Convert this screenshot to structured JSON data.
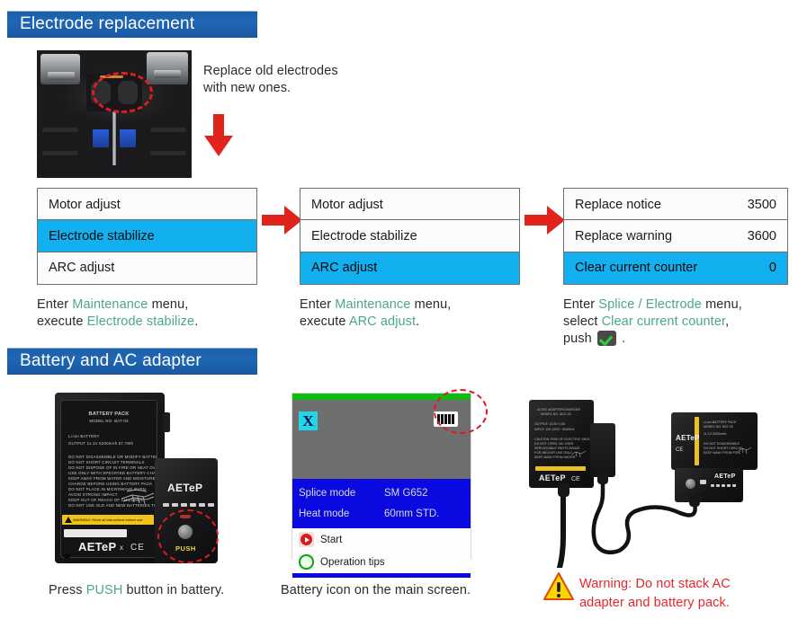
{
  "sections": {
    "electrode": {
      "banner_title": "Electrode replacement",
      "intro_line1": "Replace old electrodes",
      "intro_line2": "with new ones.",
      "photo_name": "splicer-electrode-photo"
    },
    "battery": {
      "banner_title": "Battery and AC adapter"
    }
  },
  "menus": [
    {
      "name": "maintenance-menu-electrode-stabilize",
      "rows": [
        {
          "label": "Motor adjust",
          "value": "",
          "selected": false
        },
        {
          "label": "Electrode stabilize",
          "value": "",
          "selected": true
        },
        {
          "label": "ARC adjust",
          "value": "",
          "selected": false
        }
      ],
      "caption": {
        "parts": [
          {
            "text": "Enter ",
            "style": "plain"
          },
          {
            "text": "Maintenance",
            "style": "highlight"
          },
          {
            "text": " menu,",
            "style": "plain"
          },
          {
            "text": "\n",
            "style": "break"
          },
          {
            "text": "execute ",
            "style": "plain"
          },
          {
            "text": "Electrode stabilize",
            "style": "highlight"
          },
          {
            "text": ".",
            "style": "plain"
          }
        ]
      }
    },
    {
      "name": "maintenance-menu-arc-adjust",
      "rows": [
        {
          "label": "Motor adjust",
          "value": "",
          "selected": false
        },
        {
          "label": "Electrode stabilize",
          "value": "",
          "selected": false
        },
        {
          "label": "ARC adjust",
          "value": "",
          "selected": true
        }
      ],
      "caption": {
        "parts": [
          {
            "text": "Enter ",
            "style": "plain"
          },
          {
            "text": "Maintenance",
            "style": "highlight"
          },
          {
            "text": " menu,",
            "style": "plain"
          },
          {
            "text": "\n",
            "style": "break"
          },
          {
            "text": "execute ",
            "style": "plain"
          },
          {
            "text": "ARC adjust",
            "style": "highlight"
          },
          {
            "text": ".",
            "style": "plain"
          }
        ]
      }
    },
    {
      "name": "splice-electrode-menu",
      "rows": [
        {
          "label": "Replace notice",
          "value": "3500",
          "selected": false
        },
        {
          "label": "Replace warning",
          "value": "3600",
          "selected": false
        },
        {
          "label": "Clear current counter",
          "value": "0",
          "selected": true
        }
      ],
      "caption": {
        "parts": [
          {
            "text": "Enter ",
            "style": "plain"
          },
          {
            "text": "Splice / Electrode",
            "style": "highlight"
          },
          {
            "text": " menu,",
            "style": "plain"
          },
          {
            "text": "\n",
            "style": "break"
          },
          {
            "text": "select ",
            "style": "plain"
          },
          {
            "text": "Clear current counter",
            "style": "highlight"
          },
          {
            "text": ",",
            "style": "plain"
          },
          {
            "text": "\n",
            "style": "break"
          },
          {
            "text": "push ",
            "style": "plain"
          },
          {
            "text": "",
            "style": "checkmark-icon"
          },
          {
            "text": " .",
            "style": "plain"
          }
        ]
      }
    }
  ],
  "arrows": [
    {
      "name": "arrow-down-photo-to-menu",
      "direction": "down"
    },
    {
      "name": "arrow-right-menu1-to-menu2",
      "direction": "right"
    },
    {
      "name": "arrow-right-menu2-to-menu3",
      "direction": "right"
    }
  ],
  "battery_pack": {
    "title": "BATTERY PACK",
    "model": "MODEL NO. BAT-03",
    "type": "Li-ion BATTERY",
    "output": "OUTPUT    11.1V  5200mAh  57.7Wh",
    "notes": [
      "DO NOT DISASSEMBLE OR MODIFY BATTERY PACK",
      "DO NOT SHORT CIRCUIT TERMINALS",
      "DO NOT DISPOSE OF IN FIRE OR HEAT OVER 100°C",
      "USE ONLY WITH SPECIFIED BATTERY CHARGER OR UNIT",
      "KEEP AWAY FROM WATER AND MOISTURE",
      "CHARGE BEFORE USING BATTERY PACK",
      "DO NOT PLACE IN MICROWAVE OVEN",
      "AVOID STRONG IMPACT",
      "KEEP OUT OF REACH OF CHILDREN",
      "DO NOT USE OLD AND NEW BATTERIES TOGETHER"
    ],
    "warning_strip": "WARNING: Read all instructions before use",
    "brand": "AETeP",
    "marks": "CE",
    "push_label": "PUSH"
  },
  "screen": {
    "name": "splicer-main-screen",
    "x_icon": "X",
    "battery_icon": "battery-icon",
    "rows": [
      {
        "label": "Splice mode",
        "value": "SM G652"
      },
      {
        "label": "Heat mode",
        "value": "60mm STD."
      }
    ],
    "actions": [
      {
        "label": "Start",
        "icon": "start-icon"
      },
      {
        "label": "Operation tips",
        "icon": "operation-tips-icon"
      }
    ]
  },
  "ac_adapter": {
    "title": "AC/DC ADAPTER/CHARGER",
    "model": "MODEL NO. ADC-03",
    "output": "OUTPUT:  13.5V  4.0A",
    "input": "INPUT: 100-240V~  50/60Hz",
    "brand": "AETeP",
    "marks": "CE"
  },
  "captions": {
    "battery_push": {
      "parts": [
        {
          "text": "Press ",
          "style": "plain"
        },
        {
          "text": "PUSH",
          "style": "highlight"
        },
        {
          "text": " button in battery.",
          "style": "plain"
        }
      ]
    },
    "battery_icon": "Battery icon on the main screen.",
    "warning_line1": "Warning: Do not stack AC",
    "warning_line2": "adapter and battery pack."
  },
  "colors": {
    "banner_blue": "#1e66b4",
    "selected_cyan": "#12b0ef",
    "accent_green": "#4aa888",
    "arrow_red": "#e0241c",
    "warning_red": "#e8252a",
    "warning_yellow": "#ffd500",
    "screen_blue": "#0a0ae0",
    "screen_green": "#0fbb12",
    "dashed_red": "#e01b20"
  }
}
